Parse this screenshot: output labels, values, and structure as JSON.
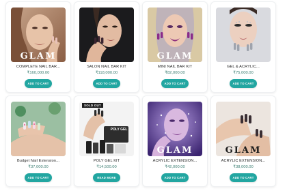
{
  "products": [
    {
      "name": "COMPLETE NAIL BAR...",
      "price": "₹160,000.00",
      "button": "ADD TO CART",
      "logo_text": "GLAM",
      "image": "woman-face-nude-nails",
      "sold_out": ""
    },
    {
      "name": "SALON NAIL BAR KIT",
      "price": "₹118,000.00",
      "button": "ADD TO CART",
      "logo_text": "",
      "image": "woman-face-dark-nails",
      "sold_out": ""
    },
    {
      "name": "MINI NAIL BAR KIT",
      "price": "₹82,000.00",
      "button": "ADD TO CART",
      "logo_text": "GLAM",
      "image": "woman-face-purple-nails",
      "sold_out": ""
    },
    {
      "name": "GEL & ACRYLIC...",
      "price": "₹75,000.00",
      "button": "ADD TO CART",
      "logo_text": "",
      "image": "woman-face-silver-nails",
      "sold_out": ""
    },
    {
      "name": "Budget Nail Extension...",
      "price": "₹37,000.00",
      "button": "ADD TO CART",
      "logo_text": "",
      "image": "hands-floral-nails",
      "sold_out": ""
    },
    {
      "name": "POLY GEL KIT",
      "price": "₹14,500.00",
      "button": "READ MORE",
      "logo_text": "POLY GEL",
      "image": "poly-gel-product-kit",
      "sold_out": "SOLD OUT"
    },
    {
      "name": "ACRYLIC EXTENSION...",
      "price": "₹42,000.00",
      "button": "ADD TO CART",
      "logo_text": "GLAM",
      "image": "glitter-face-nails",
      "sold_out": ""
    },
    {
      "name": "ACRYLIC EXTENSION...",
      "price": "₹38,000.00",
      "button": "ADD TO CART",
      "logo_text": "GLAM",
      "image": "hands-dark-nails",
      "sold_out": ""
    }
  ],
  "colors": {
    "button": "#22a6a1",
    "price": "#3d7f73",
    "sold_out_bg": "#1e1e1e"
  }
}
